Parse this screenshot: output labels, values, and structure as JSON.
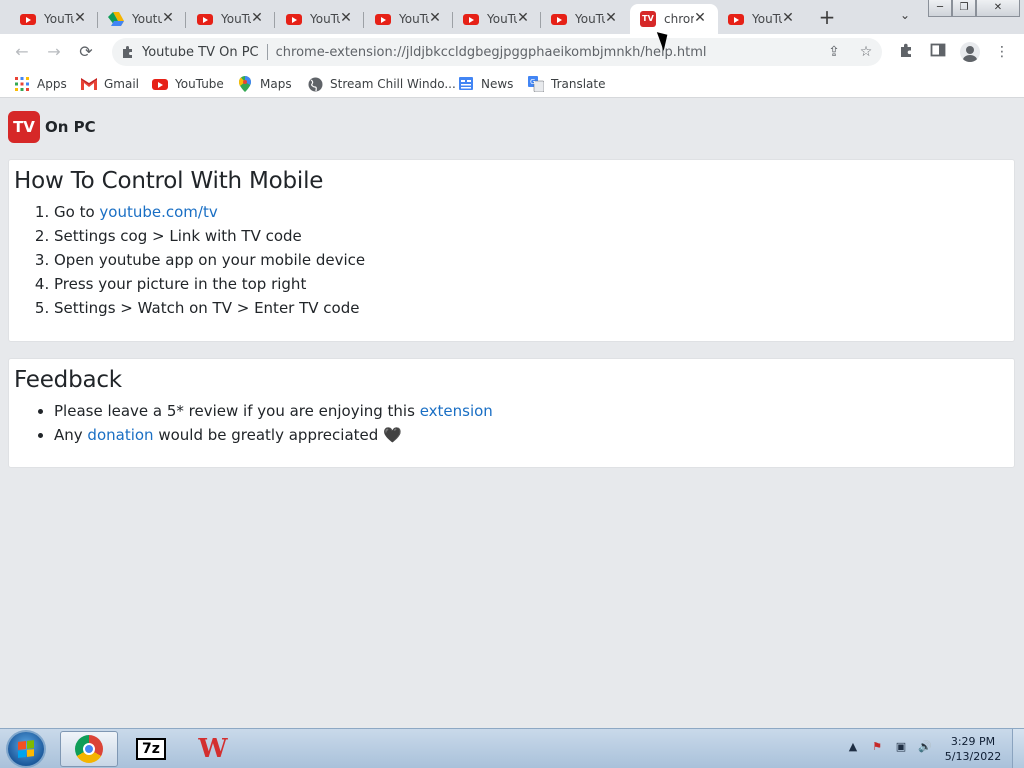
{
  "browser": {
    "tabs": [
      {
        "title": "YouTube",
        "favicon": "youtube-icon",
        "active": false
      },
      {
        "title": "Youtube TV",
        "favicon": "drive-icon",
        "active": false
      },
      {
        "title": "YouTube",
        "favicon": "youtube-icon",
        "active": false
      },
      {
        "title": "YouTube",
        "favicon": "youtube-icon",
        "active": false
      },
      {
        "title": "YouTube",
        "favicon": "youtube-icon",
        "active": false
      },
      {
        "title": "YouTube",
        "favicon": "youtube-icon",
        "active": false
      },
      {
        "title": "YouTube",
        "favicon": "youtube-icon",
        "active": false
      },
      {
        "title": "chrome-extension",
        "favicon": "tv-icon",
        "active": true
      },
      {
        "title": "YouTube",
        "favicon": "youtube-icon",
        "active": false
      }
    ],
    "new_tab": "+",
    "tab_search": "⌄",
    "window": {
      "minimize": "─",
      "restore": "❐",
      "close": "✕"
    }
  },
  "toolbar": {
    "back": "←",
    "forward": "→",
    "reload": "⟳",
    "site_name": "Youtube TV On PC",
    "url": "chrome-extension://jldjbkccldgbegjpggphaeikombjmnkh/help.html",
    "share": "⇪",
    "star": "☆",
    "extensions": "✚",
    "sidepanel": "▢",
    "menu": "⋮"
  },
  "bookmarks": [
    {
      "label": "Apps",
      "icon": "apps-grid-icon"
    },
    {
      "label": "Gmail",
      "icon": "gmail-icon"
    },
    {
      "label": "YouTube",
      "icon": "youtube-icon"
    },
    {
      "label": "Maps",
      "icon": "maps-pin-icon"
    },
    {
      "label": "Stream Chill Windo...",
      "icon": "globe-icon"
    },
    {
      "label": "News",
      "icon": "news-icon"
    },
    {
      "label": "Translate",
      "icon": "translate-icon"
    }
  ],
  "page": {
    "brand": {
      "logo": "TV",
      "name": "On PC"
    },
    "mobile_section": {
      "title": "How To Control With Mobile",
      "steps": [
        {
          "prefix": "Go to ",
          "link": "youtube.com/tv",
          "suffix": ""
        },
        {
          "prefix": "Settings cog > Link with TV code",
          "link": "",
          "suffix": ""
        },
        {
          "prefix": "Open youtube app on your mobile device",
          "link": "",
          "suffix": ""
        },
        {
          "prefix": "Press your picture in the top right",
          "link": "",
          "suffix": ""
        },
        {
          "prefix": "Settings > Watch on TV > Enter TV code",
          "link": "",
          "suffix": ""
        }
      ]
    },
    "feedback_section": {
      "title": "Feedback",
      "items": [
        {
          "prefix": "Please leave a 5* review if you are enjoying this ",
          "link": "extension",
          "suffix": ""
        },
        {
          "prefix": "Any ",
          "link": "donation",
          "suffix": " would be greatly appreciated 🖤"
        }
      ]
    }
  },
  "taskbar": {
    "apps": [
      {
        "name": "Google Chrome",
        "icon": "chrome-icon",
        "active": true
      },
      {
        "name": "7-Zip",
        "icon": "7zip-icon",
        "label": "7z",
        "active": false
      },
      {
        "name": "WPS Office",
        "icon": "wps-icon",
        "label": "W",
        "active": false
      }
    ],
    "tray": {
      "arrow": "▲",
      "flag": "⚑",
      "network": "▣",
      "volume": "🔊"
    },
    "clock": {
      "time": "3:29 PM",
      "date": "5/13/2022"
    }
  },
  "colors": {
    "accent_link": "#1a6fc4",
    "brand_red": "#d62828",
    "youtube_red": "#e62117"
  }
}
